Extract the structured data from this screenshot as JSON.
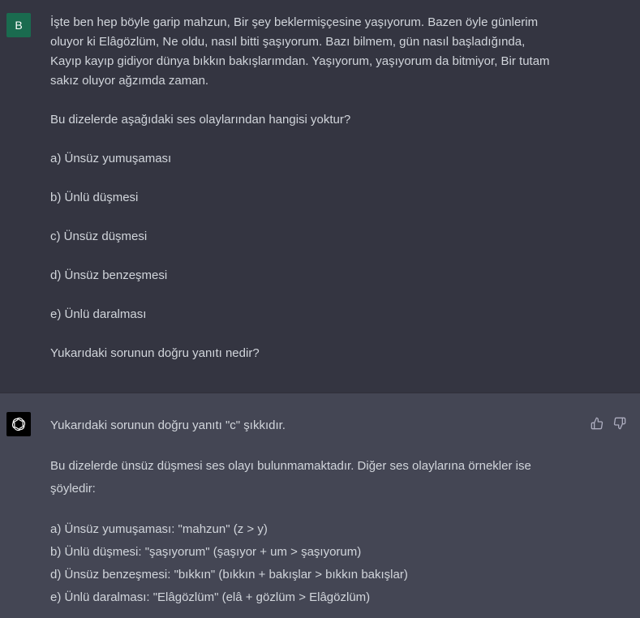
{
  "user": {
    "avatar_letter": "B",
    "intro_lines": [
      "İşte ben hep böyle garip mahzun, Bir şey beklermişçesine yaşıyorum. Bazen öyle günlerim",
      "oluyor ki Elâgözlüm, Ne oldu, nasıl bitti şaşıyorum. Bazı bilmem, gün nasıl başladığında,",
      "Kayıp kayıp gidiyor dünya bıkkın bakışlarımdan. Yaşıyorum, yaşıyorum da bitmiyor, Bir tutam",
      "sakız oluyor ağzımda zaman."
    ],
    "question": "Bu dizelerde aşağıdaki ses olaylarından hangisi yoktur?",
    "options": [
      "a) Ünsüz yumuşaması",
      "b) Ünlü düşmesi",
      "c) Ünsüz düşmesi",
      "d) Ünsüz benzeşmesi",
      "e) Ünlü daralması"
    ],
    "final_question": "Yukarıdaki sorunun doğru yanıtı nedir?"
  },
  "assistant": {
    "answer": "Yukarıdaki sorunun doğru yanıtı \"c\" şıkkıdır.",
    "explanation_lines": [
      "Bu dizelerde ünsüz düşmesi ses olayı bulunmamaktadır. Diğer ses olaylarına örnekler ise",
      "şöyledir:"
    ],
    "examples": [
      "a) Ünsüz yumuşaması: \"mahzun\" (z > y)",
      "b) Ünlü düşmesi: \"şaşıyorum\" (şaşıyor + um > şaşıyorum)",
      "d) Ünsüz benzeşmesi: \"bıkkın\" (bıkkın + bakışlar > bıkkın bakışlar)",
      "e) Ünlü daralması: \"Elâgözlüm\" (elâ + gözlüm > Elâgözlüm)"
    ]
  },
  "icons": {
    "bot_avatar": "openai-logo-icon",
    "like": "thumbs-up-icon",
    "dislike": "thumbs-down-icon"
  }
}
